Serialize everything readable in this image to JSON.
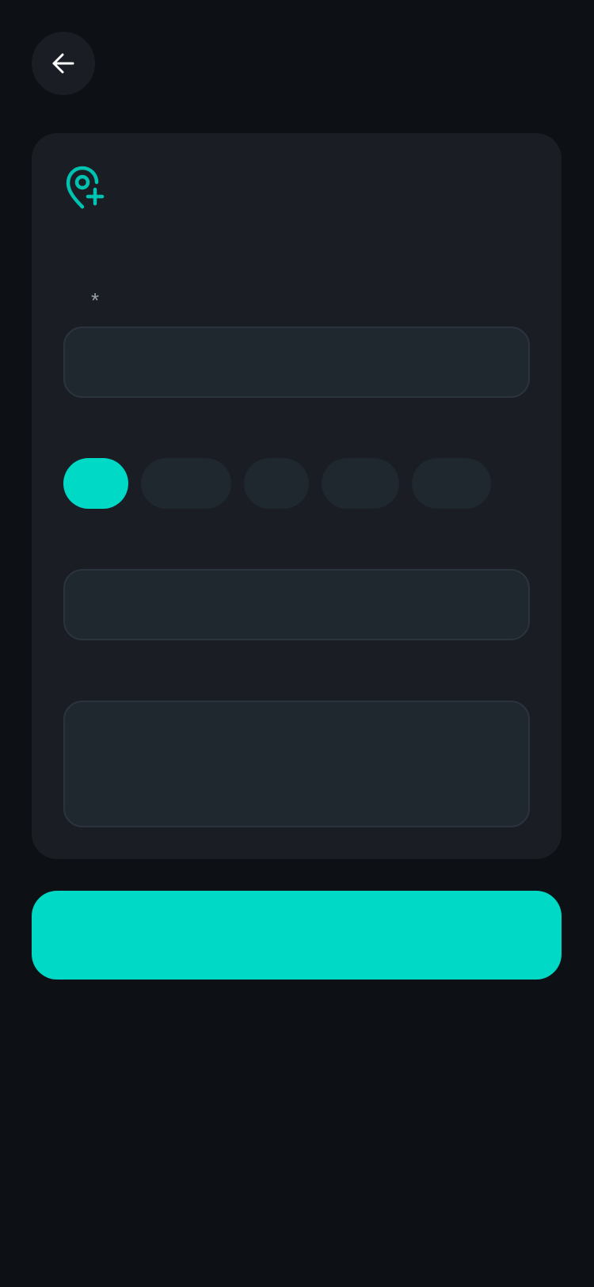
{
  "header": {
    "back_icon": "arrow-left-icon"
  },
  "card": {
    "icon": "map-pin-plus-icon",
    "title": "",
    "name_field": {
      "label": "",
      "required_mark": "*",
      "value": "",
      "placeholder": ""
    },
    "type_field": {
      "label": "",
      "chips": [
        {
          "label": "",
          "selected": true
        },
        {
          "label": "",
          "selected": false
        },
        {
          "label": "",
          "selected": false
        },
        {
          "label": "",
          "selected": false
        },
        {
          "label": "",
          "selected": false
        }
      ]
    },
    "address_field": {
      "value": "",
      "placeholder": ""
    },
    "notes_field": {
      "value": "",
      "placeholder": ""
    }
  },
  "submit": {
    "label": ""
  },
  "colors": {
    "background": "#0d1015",
    "card": "#1a1e24",
    "input_bg": "#1f272f",
    "input_border": "#2b333c",
    "accent": "#00d9c6"
  }
}
